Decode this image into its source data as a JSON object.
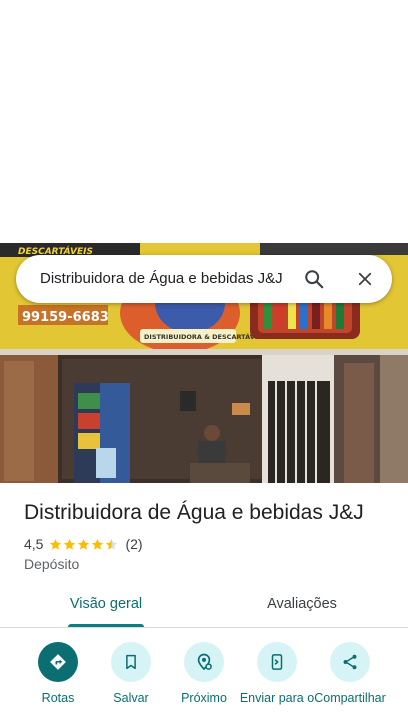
{
  "search": {
    "query": "Distribuidora de Água e bebidas J&J"
  },
  "photo": {
    "sign_top_text": "DESCARTÁVEIS",
    "sign_phone": "99159-6683",
    "sign_badge_text": "DISTRIBUIDORA & DESCARTÁVEIS"
  },
  "place": {
    "title": "Distribuidora de Água e bebidas J&J",
    "rating": "4,5",
    "stars": 4.5,
    "review_count": "(2)",
    "category": "Depósito"
  },
  "tabs": [
    {
      "label": "Visão geral",
      "active": true
    },
    {
      "label": "Avaliações",
      "active": false
    }
  ],
  "actions": [
    {
      "label": "Rotas",
      "icon": "directions-icon"
    },
    {
      "label": "Salvar",
      "icon": "bookmark-icon"
    },
    {
      "label": "Próximo",
      "icon": "nearby-icon"
    },
    {
      "label": "Enviar para o",
      "icon": "send-to-phone-icon"
    },
    {
      "label": "Compartilhar",
      "icon": "share-icon"
    }
  ],
  "colors": {
    "accent": "#0b6e72",
    "accent_light": "#d6f3f6",
    "star": "#fbbc04"
  }
}
